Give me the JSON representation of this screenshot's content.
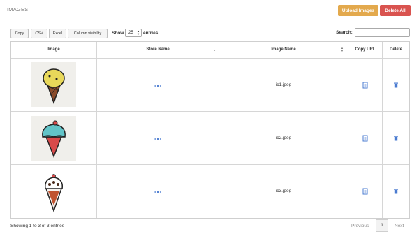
{
  "header": {
    "tab_label": "IMAGES",
    "upload_label": "Upload Images",
    "delete_all_label": "Delete All"
  },
  "toolbar": {
    "copy": "Copy",
    "csv": "CSV",
    "excel": "Excel",
    "column_visibility": "Column visibility",
    "show_label": "Show",
    "entries_value": "25",
    "entries_label": "entries",
    "search_label": "Search:"
  },
  "table": {
    "columns": [
      "Image",
      "Store Name",
      "Image Name",
      "Copy URL",
      "Delete"
    ],
    "rows": [
      {
        "image_name": "ic1.jpeg",
        "image_icon": "ice-cream-yellow-icon"
      },
      {
        "image_name": "ic2.jpeg",
        "image_icon": "ice-cream-blue-icon"
      },
      {
        "image_name": "ic3.jpeg",
        "image_icon": "ice-cream-chocolate-icon"
      }
    ]
  },
  "footer": {
    "info": "Showing 1 to 3 of 3 entries",
    "previous": "Previous",
    "current_page": "1",
    "next": "Next"
  },
  "colors": {
    "upload_button": "#e3a94d",
    "delete_button": "#d9534f",
    "icon_blue": "#4a7bd0"
  }
}
